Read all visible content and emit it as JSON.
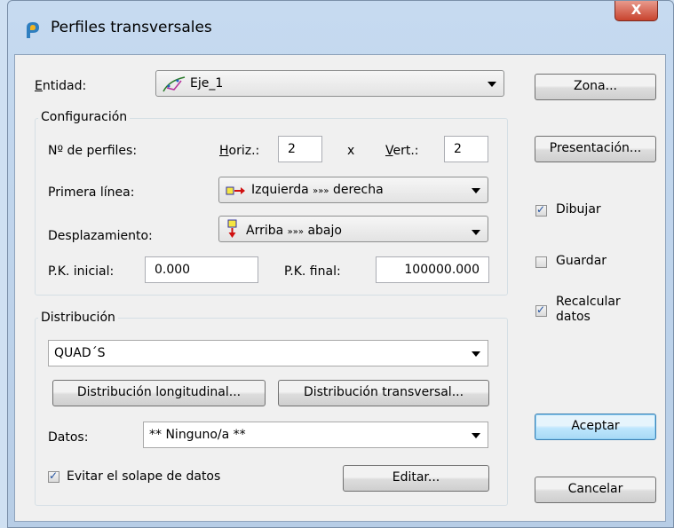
{
  "window": {
    "title": "Perfiles transversales",
    "close_glyph": "X"
  },
  "entidad": {
    "label": "Entidad:",
    "value": "Eje_1",
    "icon": "axis-line-icon"
  },
  "configuracion": {
    "title": "Configuración",
    "num_perfiles_label": "Nº de perfiles:",
    "horiz_label": "Horiz.:",
    "horiz_value": "2",
    "x_label": "x",
    "vert_label": "Vert.:",
    "vert_value": "2",
    "primera_linea_label": "Primera línea:",
    "primera_linea_value_a": "Izquierda",
    "primera_linea_sep": "»»»",
    "primera_linea_value_b": "derecha",
    "desplazamiento_label": "Desplazamiento:",
    "desplazamiento_value_a": "Arriba",
    "desplazamiento_sep": "»»»",
    "desplazamiento_value_b": "abajo",
    "pk_inicial_label": "P.K. inicial:",
    "pk_inicial_value": "0.000",
    "pk_final_label": "P.K. final:",
    "pk_final_value": "100000.000"
  },
  "distribucion": {
    "title": "Distribución",
    "combo_value": "QUAD´S",
    "longitudinal_button": "Distribución longitudinal...",
    "transversal_button": "Distribución transversal...",
    "datos_label": "Datos:",
    "datos_value": "** Ninguno/a **",
    "evitar_label": "Evitar el solape de datos",
    "evitar_checked": true,
    "editar_button": "Editar..."
  },
  "side": {
    "zona_button": "Zona...",
    "presentacion_button": "Presentación...",
    "dibujar_label": "Dibujar",
    "dibujar_checked": true,
    "guardar_label": "Guardar",
    "guardar_checked": false,
    "recalcular_label_1": "Recalcular",
    "recalcular_label_2": "datos",
    "recalcular_checked": true,
    "aceptar_button": "Aceptar",
    "cancelar_button": "Cancelar"
  },
  "colors": {
    "accent_blue": "#3c7fb1",
    "titlebar": "#c6daf0",
    "close_red": "#c8432e"
  }
}
